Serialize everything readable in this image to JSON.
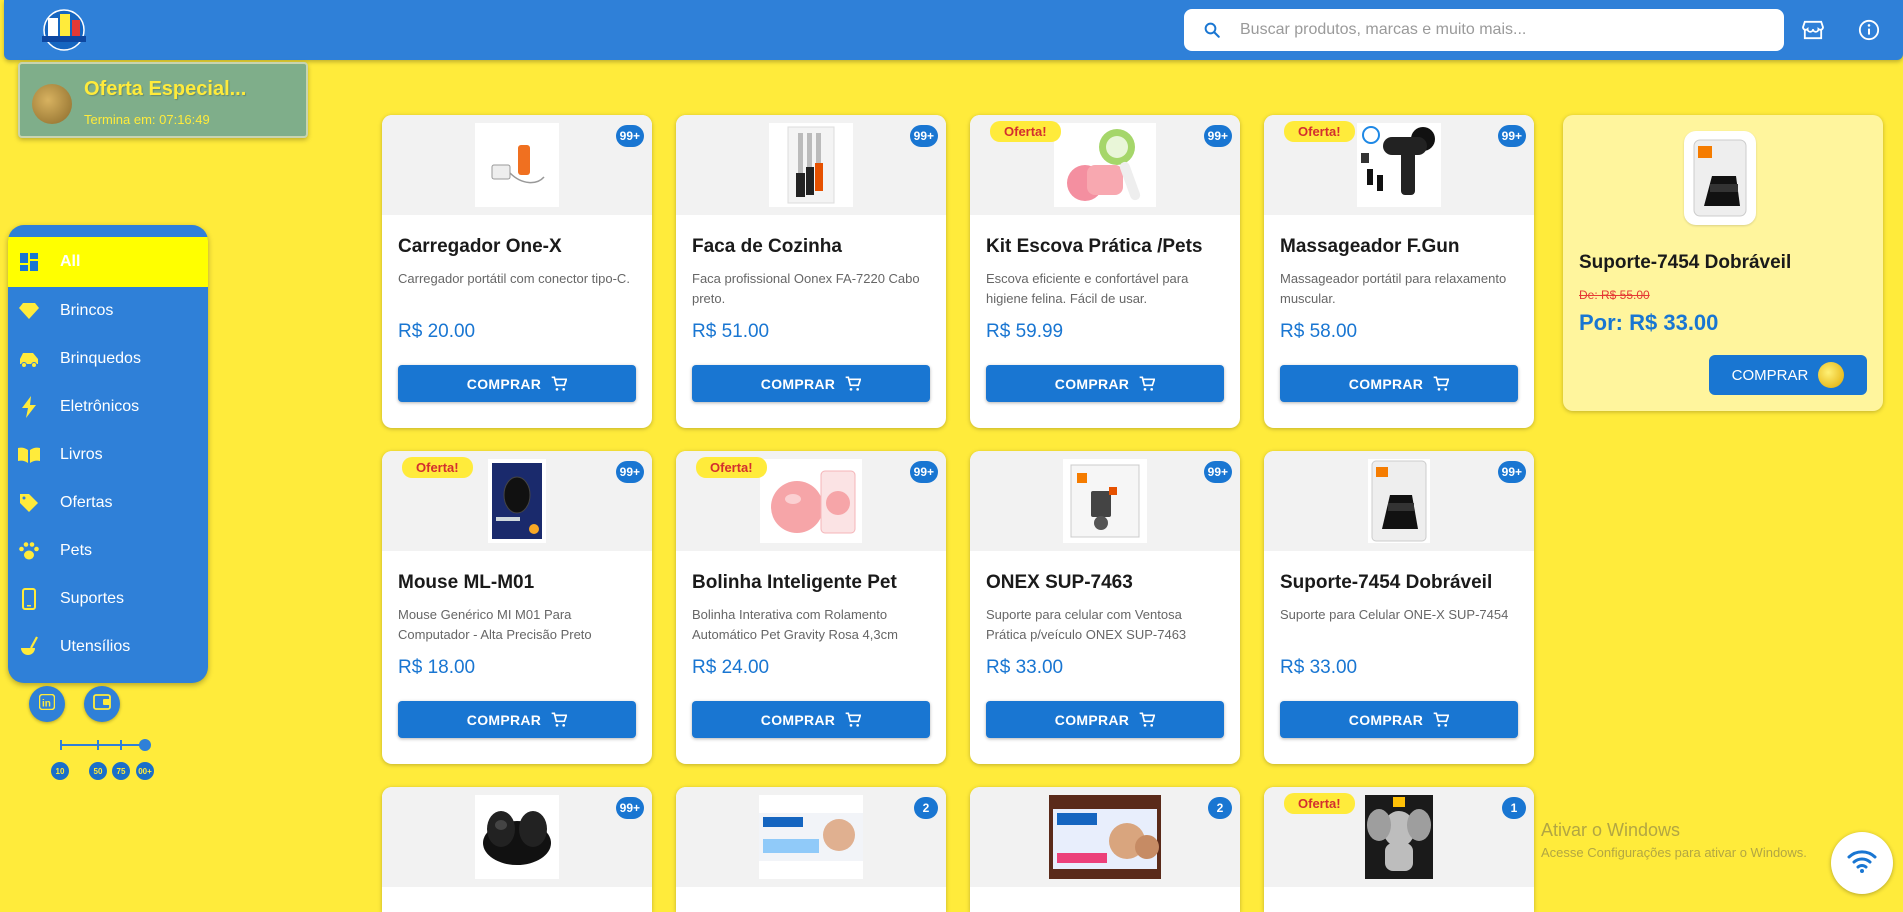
{
  "header": {
    "search_placeholder": "Buscar produtos, marcas e muito mais...",
    "icons": [
      "search-icon",
      "store-icon",
      "info-icon"
    ]
  },
  "offer": {
    "title": "Oferta Especial...",
    "timer": "Termina em: 07:16:49"
  },
  "sidebar": {
    "items": [
      {
        "label": "All",
        "icon": "dashboard-icon",
        "active": true
      },
      {
        "label": "Brincos",
        "icon": "diamond-icon"
      },
      {
        "label": "Brinquedos",
        "icon": "toy-car-icon"
      },
      {
        "label": "Eletrônicos",
        "icon": "bolt-icon"
      },
      {
        "label": "Livros",
        "icon": "book-icon"
      },
      {
        "label": "Ofertas",
        "icon": "tag-icon"
      },
      {
        "label": "Pets",
        "icon": "paw-icon"
      },
      {
        "label": "Suportes",
        "icon": "phone-icon"
      },
      {
        "label": "Utensílios",
        "icon": "soup-kitchen-icon"
      }
    ]
  },
  "social": [
    "linkedin-icon",
    "wallet-icon"
  ],
  "slider": {
    "labels": [
      "10",
      "50",
      "75",
      "00+"
    ],
    "selected": "00+"
  },
  "products": [
    {
      "name": "Carregador One-X",
      "desc": "Carregador portátil com conector tipo-C.",
      "price": "R$ 20.00",
      "badge": "99+",
      "oferta": false,
      "buy": "COMPRAR"
    },
    {
      "name": "Faca de Cozinha",
      "desc": "Faca profissional Oonex FA-7220 Cabo preto.",
      "price": "R$ 51.00",
      "badge": "99+",
      "oferta": false,
      "buy": "COMPRAR"
    },
    {
      "name": "Kit Escova Prática /Pets",
      "desc": "Escova eficiente e confortável para higiene felina. Fácil de usar.",
      "price": "R$ 59.99",
      "badge": "99+",
      "oferta": true,
      "buy": "COMPRAR"
    },
    {
      "name": "Massageador F.Gun",
      "desc": "Massageador portátil para relaxamento muscular.",
      "price": "R$ 58.00",
      "badge": "99+",
      "oferta": true,
      "buy": "COMPRAR"
    },
    {
      "name": "Mouse ML-M01",
      "desc": "Mouse Genérico MI M01 Para Computador - Alta Precisão Preto",
      "price": "R$ 18.00",
      "badge": "99+",
      "oferta": true,
      "buy": "COMPRAR"
    },
    {
      "name": "Bolinha Inteligente Pet",
      "desc": "Bolinha Interativa com Rolamento Automático Pet Gravity Rosa 4,3cm",
      "price": "R$ 24.00",
      "badge": "99+",
      "oferta": true,
      "buy": "COMPRAR"
    },
    {
      "name": "ONEX SUP-7463",
      "desc": "Suporte para celular com Ventosa Prática p/veículo ONEX SUP-7463",
      "price": "R$ 33.00",
      "badge": "99+",
      "oferta": false,
      "buy": "COMPRAR"
    },
    {
      "name": "Suporte-7454 Dobráveil",
      "desc": "Suporte para Celular ONE-X SUP-7454",
      "price": "R$ 33.00",
      "badge": "99+",
      "oferta": false,
      "buy": "COMPRAR"
    }
  ],
  "partial_products": [
    {
      "badge": "99+",
      "oferta": false
    },
    {
      "badge": "2",
      "oferta": false
    },
    {
      "badge": "2",
      "oferta": false
    },
    {
      "badge": "1",
      "oferta": true
    }
  ],
  "oferta_label": "Oferta!",
  "featured": {
    "name": "Suporte-7454 Dobráveil",
    "old_price": "De: R$ 55.00",
    "new_price": "Por: R$ 33.00",
    "buy": "COMPRAR"
  },
  "windows_watermark": {
    "line1": "Ativar o Windows",
    "line2": "Acesse Configurações para ativar o Windows."
  },
  "colors": {
    "background": "#ffeb3b",
    "primary": "#1976d2",
    "header": "#2f80d8",
    "sidebar_active": "#ffff00",
    "oferta_text": "#d32f2f"
  }
}
